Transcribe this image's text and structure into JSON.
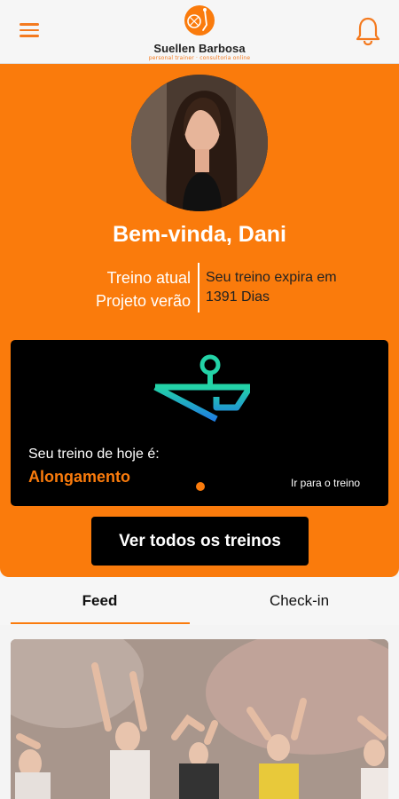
{
  "brand": {
    "name": "Suellen Barbosa",
    "tagline": "personal trainer · consultoria online"
  },
  "hero": {
    "welcome": "Bem-vinda, Dani",
    "current_label": "Treino atual",
    "current_plan": "Projeto verão",
    "expire_label": "Seu treino expira em",
    "expire_value": "1391 Dias"
  },
  "today": {
    "label": "Seu treino de hoje é:",
    "name": "Alongamento",
    "link": "Ir para o treino"
  },
  "all_button": "Ver todos os treinos",
  "tabs": [
    {
      "label": "Feed",
      "active": true
    },
    {
      "label": "Check-in",
      "active": false
    }
  ],
  "colors": {
    "accent": "#fa7b0c",
    "icon_teal": "#23d3a7",
    "icon_blue": "#1f7fe0"
  },
  "icons": {
    "menu": "menu-icon",
    "bell": "bell-icon",
    "workout": "stretching-figure-icon"
  }
}
